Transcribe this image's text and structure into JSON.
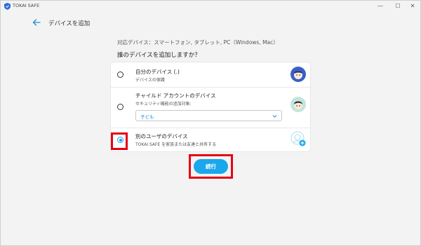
{
  "window": {
    "title": "TOKAI SAFE",
    "controls": {
      "minimize": "—",
      "maximize": "☐",
      "close": "✕"
    }
  },
  "header": {
    "back_icon": "back-arrow-icon",
    "title": "デバイスを追加"
  },
  "supported_devices": "対応デバイス：スマートフォン, タブレット, PC（Windows, Mac）",
  "question": "誰のデバイスを追加しますか？",
  "options": [
    {
      "title": "自分のデバイス (.)",
      "subtitle": "デバイスの保護",
      "selected": false,
      "icon": "adult-avatar-icon"
    },
    {
      "title": "チャイルド アカウントのデバイス",
      "subtitle": "セキュリティ機能の追加対象:",
      "selected": false,
      "icon": "child-avatar-icon",
      "select_value": "子ども"
    },
    {
      "title": "別のユーザのデバイス",
      "subtitle": "TOKAI SAFE を家族または友達と共有する",
      "selected": true,
      "icon": "add-user-avatar-icon"
    }
  ],
  "continue_label": "続行",
  "colors": {
    "accent": "#1ba7eb",
    "highlight": "#e60012"
  }
}
